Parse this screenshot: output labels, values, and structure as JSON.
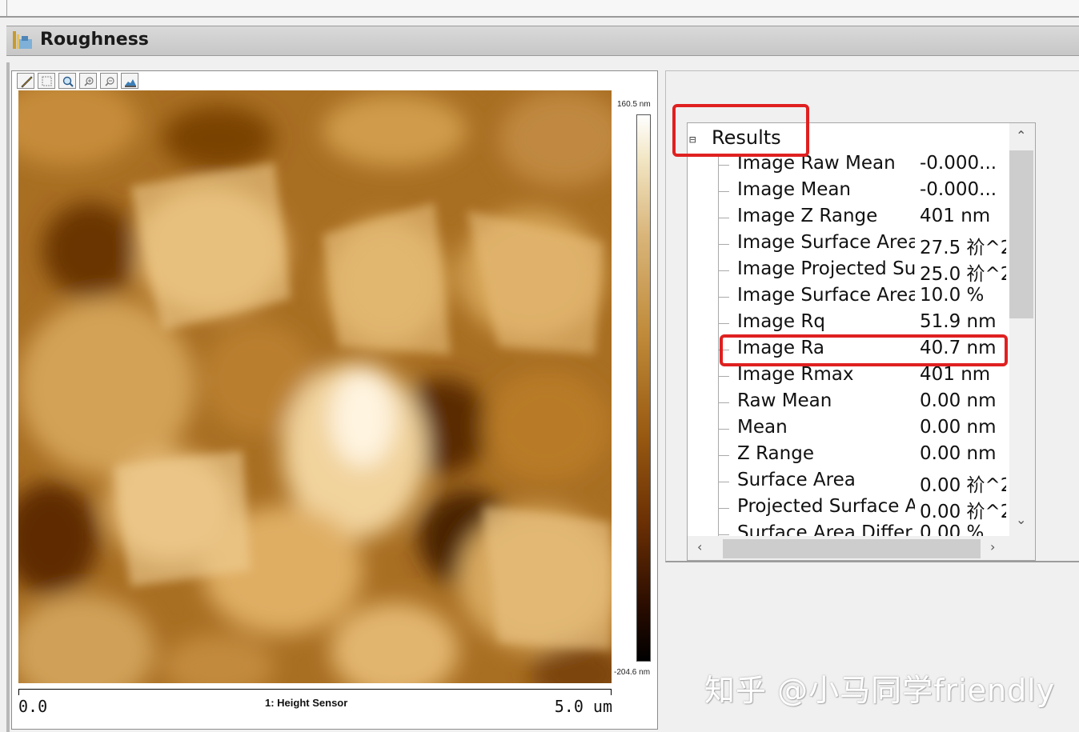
{
  "window": {
    "title": "Roughness"
  },
  "image_panel": {
    "toolbar_tools": [
      "measure-icon",
      "select-icon",
      "zoom-icon",
      "zoom-in-icon",
      "zoom-out-icon",
      "3d-view-icon"
    ],
    "colorbar_max": "160.5 nm",
    "colorbar_min": "-204.6 nm",
    "scale_start": "0.0",
    "scale_end": "5.0 um",
    "channel_label": "1: Height Sensor"
  },
  "results": {
    "root_label": "Results",
    "rows": [
      {
        "name": "Image Raw Mean",
        "value": "-0.000..."
      },
      {
        "name": "Image Mean",
        "value": "-0.000..."
      },
      {
        "name": "Image Z Range",
        "value": "401 nm"
      },
      {
        "name": "Image Surface Area",
        "value": "27.5 祄^2"
      },
      {
        "name": "Image Projected Su",
        "value": "25.0 祄^2"
      },
      {
        "name": "Image Surface Area",
        "value": "10.0 %"
      },
      {
        "name": "Image Rq",
        "value": "51.9 nm"
      },
      {
        "name": "Image Ra",
        "value": "40.7 nm"
      },
      {
        "name": "Image Rmax",
        "value": "401 nm"
      },
      {
        "name": "Raw Mean",
        "value": "0.00 nm"
      },
      {
        "name": "Mean",
        "value": "0.00 nm"
      },
      {
        "name": "Z Range",
        "value": "0.00 nm"
      },
      {
        "name": "Surface Area",
        "value": "0.00 祄^2"
      },
      {
        "name": "Projected Surface A",
        "value": "0.00 祄^2"
      },
      {
        "name": "Surface Area Differ",
        "value": "0.00 %"
      }
    ]
  },
  "watermark": "知乎 @小马同学friendly",
  "colors": {
    "highlight": "#e02020",
    "colorbar_top": "#ffffff",
    "colorbar_bottom": "#000000"
  }
}
